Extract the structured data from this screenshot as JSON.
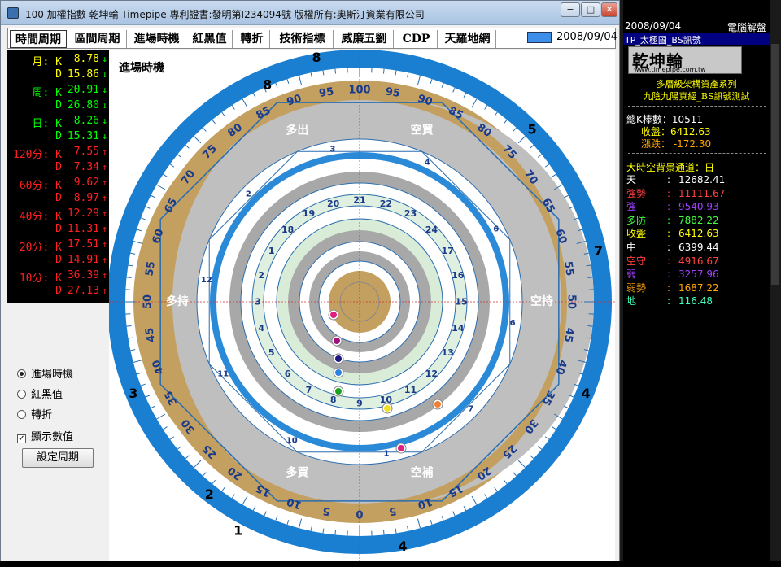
{
  "window": {
    "title": "100 加權指數    乾坤輪 Timepipe 專利證書:發明第I234094號 版權所有:奧斯汀資業有限公司",
    "min": "−",
    "max": "□",
    "close": "✕"
  },
  "menu": {
    "items": [
      "時間周期",
      "區間周期",
      "進場時機",
      "紅黑值",
      "轉折",
      "技術指標",
      "威廉五劉",
      "CDP",
      "天羅地網"
    ],
    "date": "2008/09/04"
  },
  "kd": [
    {
      "label": "月: K",
      "value": "8.78",
      "color": "#ffff00",
      "arrow": "↓",
      "arrow_color": "#00ff00"
    },
    {
      "label": "D",
      "value": "15.86",
      "color": "#ffff00",
      "arrow": "↓",
      "arrow_color": "#00ff00"
    },
    {
      "label": "周: K",
      "value": "20.91",
      "color": "#00ff00",
      "arrow": "↓",
      "arrow_color": "#00ff00"
    },
    {
      "label": "D",
      "value": "26.80",
      "color": "#00ff00",
      "arrow": "↓",
      "arrow_color": "#00ff00"
    },
    {
      "label": "日: K",
      "value": "8.26",
      "color": "#00ff00",
      "arrow": "↓",
      "arrow_color": "#00ff00"
    },
    {
      "label": "D",
      "value": "15.31",
      "color": "#00ff00",
      "arrow": "↓",
      "arrow_color": "#00ff00"
    },
    {
      "label": "120分: K",
      "value": "7.55",
      "color": "#ff2020",
      "arrow": "↑",
      "arrow_color": "#ff2020"
    },
    {
      "label": "D",
      "value": "7.34",
      "color": "#ff2020",
      "arrow": "↑",
      "arrow_color": "#ff2020"
    },
    {
      "label": "60分: K",
      "value": "9.62",
      "color": "#ff2020",
      "arrow": "↑",
      "arrow_color": "#ff2020"
    },
    {
      "label": "D",
      "value": "8.97",
      "color": "#ff2020",
      "arrow": "↑",
      "arrow_color": "#ff2020"
    },
    {
      "label": "40分: K",
      "value": "12.29",
      "color": "#ff2020",
      "arrow": "↑",
      "arrow_color": "#ff2020"
    },
    {
      "label": "D",
      "value": "11.31",
      "color": "#ff2020",
      "arrow": "↑",
      "arrow_color": "#ff2020"
    },
    {
      "label": "20分: K",
      "value": "17.51",
      "color": "#ff2020",
      "arrow": "↑",
      "arrow_color": "#ff2020"
    },
    {
      "label": "D",
      "value": "14.91",
      "color": "#ff2020",
      "arrow": "↑",
      "arrow_color": "#ff2020"
    },
    {
      "label": "10分: K",
      "value": "36.39",
      "color": "#ff2020",
      "arrow": "↑",
      "arrow_color": "#ff2020"
    },
    {
      "label": "D",
      "value": "27.13",
      "color": "#ff2020",
      "arrow": "↑",
      "arrow_color": "#ff2020"
    }
  ],
  "options": {
    "radio1": "進場時機",
    "radio2": "紅黑值",
    "radio3": "轉折",
    "check": "顯示數值",
    "check_mark": "✓",
    "button": "設定周期"
  },
  "chart": {
    "title": "進場時機",
    "outer_numbers": [
      "8",
      "5",
      "7",
      "4",
      "3",
      "2",
      "1",
      "4",
      "8"
    ],
    "scale": [
      "100",
      "95",
      "90",
      "85",
      "80",
      "75",
      "70",
      "65",
      "60",
      "55",
      "50",
      "45",
      "40",
      "35",
      "30",
      "25",
      "20",
      "15",
      "10",
      "5",
      "0",
      "5",
      "10",
      "15",
      "20",
      "25",
      "30",
      "35",
      "40",
      "45",
      "50",
      "55",
      "60",
      "65",
      "70",
      "75",
      "80",
      "85",
      "90",
      "95"
    ],
    "quad": [
      "多出",
      "空買",
      "多持",
      "空持",
      "多買",
      "空補"
    ],
    "ring_digits": [
      "3",
      "4",
      "6",
      "6",
      "7",
      "1",
      "10",
      "11",
      "12",
      "2"
    ],
    "ring_inner": [
      "18",
      "19",
      "20",
      "21",
      "22",
      "23",
      "24",
      "17",
      "16",
      "15",
      "14",
      "13",
      "12",
      "11",
      "10",
      "9",
      "8",
      "7",
      "6",
      "5",
      "4",
      "3",
      "2",
      "1"
    ]
  },
  "right": {
    "date": "2008/09/04",
    "app": "電腦解盤",
    "section": "TP_太極圖_BS訊號",
    "logo": "乾坤輪",
    "logo_url": "www.timepipe.com.tw",
    "sub1": "多層級架構資產系列",
    "sub2": "九陰九陽真經_BS訊號測試",
    "count_label": "總K棒數：10511",
    "close_label": "收盤：6412.63",
    "change_label": "漲跌： -172.30",
    "range_label": "大時空背景通道：日",
    "levels": [
      {
        "label": "天",
        "value": "12682.41",
        "color": "#ffffff"
      },
      {
        "label": "強勢",
        "value": "11111.67",
        "color": "#ff4040"
      },
      {
        "label": "強",
        "value": "9540.93",
        "color": "#a040ff"
      },
      {
        "label": "多防",
        "value": "7882.22",
        "color": "#40ff40"
      },
      {
        "label": "收盤",
        "value": "6412.63",
        "color": "#ffff00"
      },
      {
        "label": "中",
        "value": "6399.44",
        "color": "#ffffff"
      },
      {
        "label": "空守",
        "value": "4916.67",
        "color": "#ff4040"
      },
      {
        "label": "弱",
        "value": "3257.96",
        "color": "#a040ff"
      },
      {
        "label": "弱勢",
        "value": "1687.22",
        "color": "#ffa500"
      },
      {
        "label": "地",
        "value": "116.48",
        "color": "#40ffc0"
      }
    ]
  }
}
